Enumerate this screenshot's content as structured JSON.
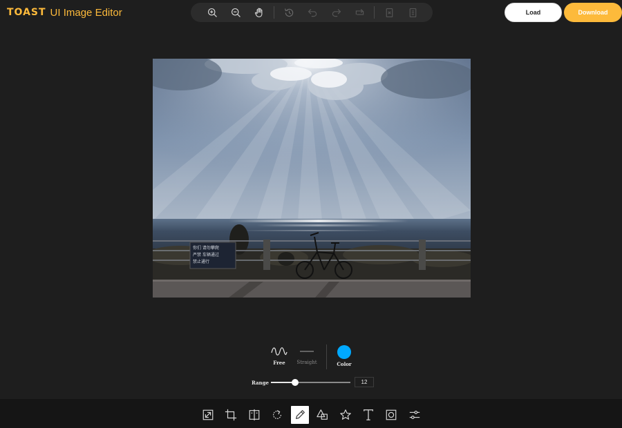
{
  "header": {
    "logo_bold": "TOAST",
    "logo_rest": "UI Image Editor",
    "load_label": "Load",
    "download_label": "Download"
  },
  "top_toolbar": {
    "items": [
      {
        "icon": "zoom-in-icon",
        "enabled": true
      },
      {
        "icon": "zoom-out-icon",
        "enabled": true
      },
      {
        "icon": "hand-icon",
        "enabled": true
      },
      {
        "icon": "history-icon",
        "enabled": false
      },
      {
        "icon": "undo-icon",
        "enabled": false
      },
      {
        "icon": "redo-icon",
        "enabled": false
      },
      {
        "icon": "reset-icon",
        "enabled": false
      },
      {
        "icon": "delete-icon",
        "enabled": false
      },
      {
        "icon": "delete-all-icon",
        "enabled": false
      }
    ]
  },
  "draw_menu": {
    "free_label": "Free",
    "straight_label": "Straight",
    "color_label": "Color",
    "color_value": "#00a9ff",
    "range_label": "Range",
    "range_value": "12",
    "range_fraction": 0.3
  },
  "bottom_menu": {
    "items": [
      {
        "icon": "resize-icon",
        "active": false
      },
      {
        "icon": "crop-icon",
        "active": false
      },
      {
        "icon": "flip-icon",
        "active": false
      },
      {
        "icon": "rotate-icon",
        "active": false
      },
      {
        "icon": "draw-icon",
        "active": true
      },
      {
        "icon": "shape-icon",
        "active": false
      },
      {
        "icon": "icon-star-icon",
        "active": false
      },
      {
        "icon": "text-icon",
        "active": false
      },
      {
        "icon": "mask-icon",
        "active": false
      },
      {
        "icon": "filter-icon",
        "active": false
      }
    ]
  },
  "colors": {
    "accent": "#fdba3b",
    "background": "#1e1e1e",
    "toolbar": "#2c2c2c",
    "bottom_bar": "#151515"
  },
  "photo": {
    "sign_text_line1": "你们 请勿攀爬",
    "sign_text_line2": "严禁 车辆通过",
    "sign_text_line3": "禁止通行"
  }
}
